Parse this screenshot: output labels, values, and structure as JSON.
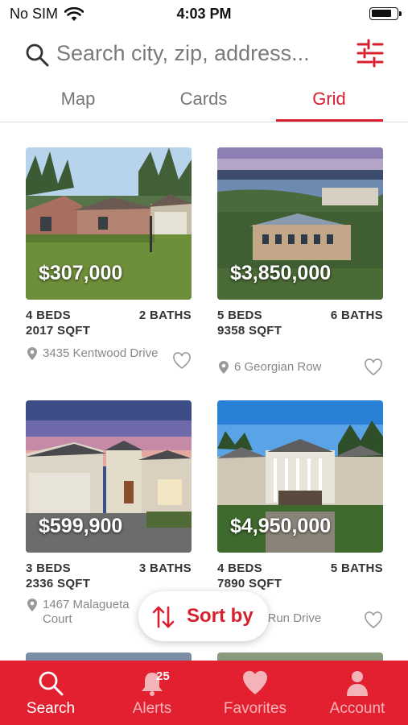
{
  "status_bar": {
    "carrier": "No SIM",
    "time": "4:03 PM"
  },
  "search": {
    "placeholder": "Search city, zip, address..."
  },
  "tabs": [
    {
      "label": "Map"
    },
    {
      "label": "Cards"
    },
    {
      "label": "Grid",
      "active": true
    }
  ],
  "listings": [
    {
      "price": "$307,000",
      "beds": "4 BEDS",
      "baths": "2 BATHS",
      "sqft": "2017 SQFT",
      "address": "3435 Kentwood Drive"
    },
    {
      "price": "$3,850,000",
      "beds": "5 BEDS",
      "baths": "6 BATHS",
      "sqft": "9358 SQFT",
      "address": "6 Georgian Row"
    },
    {
      "price": "$599,900",
      "beds": "3 BEDS",
      "baths": "3 BATHS",
      "sqft": "2336 SQFT",
      "address": "1467 Malagueta Court"
    },
    {
      "price": "$4,950,000",
      "beds": "4 BEDS",
      "baths": "5 BATHS",
      "sqft": "7890 SQFT",
      "address": "e Run Drive"
    }
  ],
  "sort": {
    "label": "Sort by"
  },
  "bottom_nav": [
    {
      "label": "Search",
      "icon": "search-icon",
      "active": true
    },
    {
      "label": "Alerts",
      "icon": "bell-icon",
      "badge": "25"
    },
    {
      "label": "Favorites",
      "icon": "heart-icon"
    },
    {
      "label": "Account",
      "icon": "person-icon"
    }
  ],
  "colors": {
    "brand_red": "#e2202f",
    "accent_red": "#d71f2e"
  }
}
